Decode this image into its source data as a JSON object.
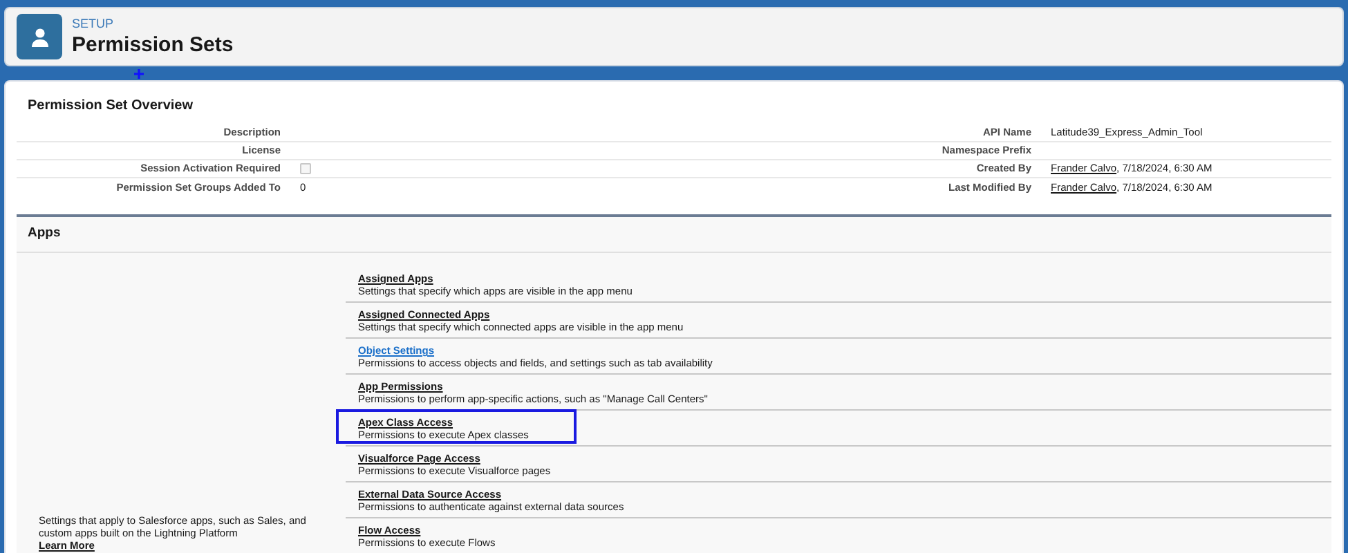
{
  "header": {
    "eyebrow": "SETUP",
    "title": "Permission Sets"
  },
  "overview": {
    "title": "Permission Set Overview",
    "rows": [
      {
        "label": "Description",
        "value": "",
        "right_label": "API Name",
        "right_value": "Latitude39_Express_Admin_Tool"
      },
      {
        "label": "License",
        "value": "",
        "right_label": "Namespace Prefix",
        "right_value": ""
      },
      {
        "label": "Session Activation Required",
        "kind": "checkbox",
        "checked": false,
        "right_label": "Created By",
        "right_link": "Frander Calvo",
        "right_value": ", 7/18/2024, 6:30 AM"
      },
      {
        "label": "Permission Set Groups Added To",
        "value": "0",
        "right_label": "Last Modified By",
        "right_link": "Frander Calvo",
        "right_value": ", 7/18/2024, 6:30 AM"
      }
    ]
  },
  "apps": {
    "title": "Apps",
    "description": "Settings that apply to Salesforce apps, such as Sales, and custom apps built on the Lightning Platform",
    "learn_more": "Learn More",
    "items": [
      {
        "title": "Assigned Apps",
        "text": "Settings that specify which apps are visible in the app menu",
        "hovered": false,
        "highlighted": false
      },
      {
        "title": "Assigned Connected Apps",
        "text": "Settings that specify which connected apps are visible in the app menu",
        "hovered": false,
        "highlighted": false
      },
      {
        "title": "Object Settings",
        "text": "Permissions to access objects and fields, and settings such as tab availability",
        "hovered": true,
        "highlighted": false
      },
      {
        "title": "App Permissions",
        "text": "Permissions to perform app-specific actions, such as \"Manage Call Centers\"",
        "hovered": false,
        "highlighted": false
      },
      {
        "title": "Apex Class Access",
        "text": "Permissions to execute Apex classes",
        "hovered": false,
        "highlighted": true
      },
      {
        "title": "Visualforce Page Access",
        "text": "Permissions to execute Visualforce pages",
        "hovered": false,
        "highlighted": false
      },
      {
        "title": "External Data Source Access",
        "text": "Permissions to authenticate against external data sources",
        "hovered": false,
        "highlighted": false
      },
      {
        "title": "Flow Access",
        "text": "Permissions to execute Flows",
        "hovered": false,
        "highlighted": false
      }
    ]
  }
}
